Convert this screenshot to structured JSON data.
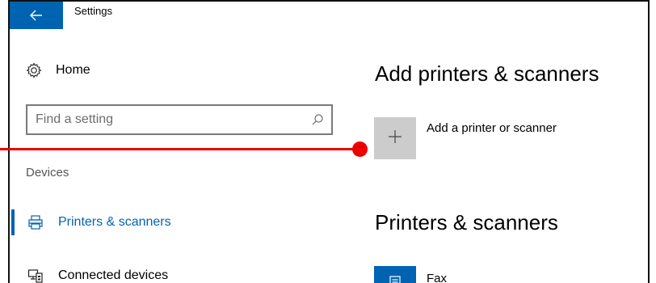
{
  "window": {
    "title": "Settings"
  },
  "sidebar": {
    "home_label": "Home",
    "search": {
      "placeholder": "Find a setting",
      "value": ""
    },
    "section_label": "Devices",
    "items": [
      {
        "label": "Printers & scanners",
        "icon": "printer-icon",
        "active": true
      },
      {
        "label": "Connected devices",
        "icon": "connected-devices-icon",
        "active": false
      }
    ]
  },
  "main": {
    "add_heading": "Add printers & scanners",
    "add_label": "Add a printer or scanner",
    "list_heading": "Printers & scanners",
    "printers": [
      {
        "label": "Fax",
        "icon": "fax-icon"
      }
    ]
  },
  "colors": {
    "accent": "#0063b1",
    "annotation": "#ee0000",
    "tile": "#cccccc"
  }
}
